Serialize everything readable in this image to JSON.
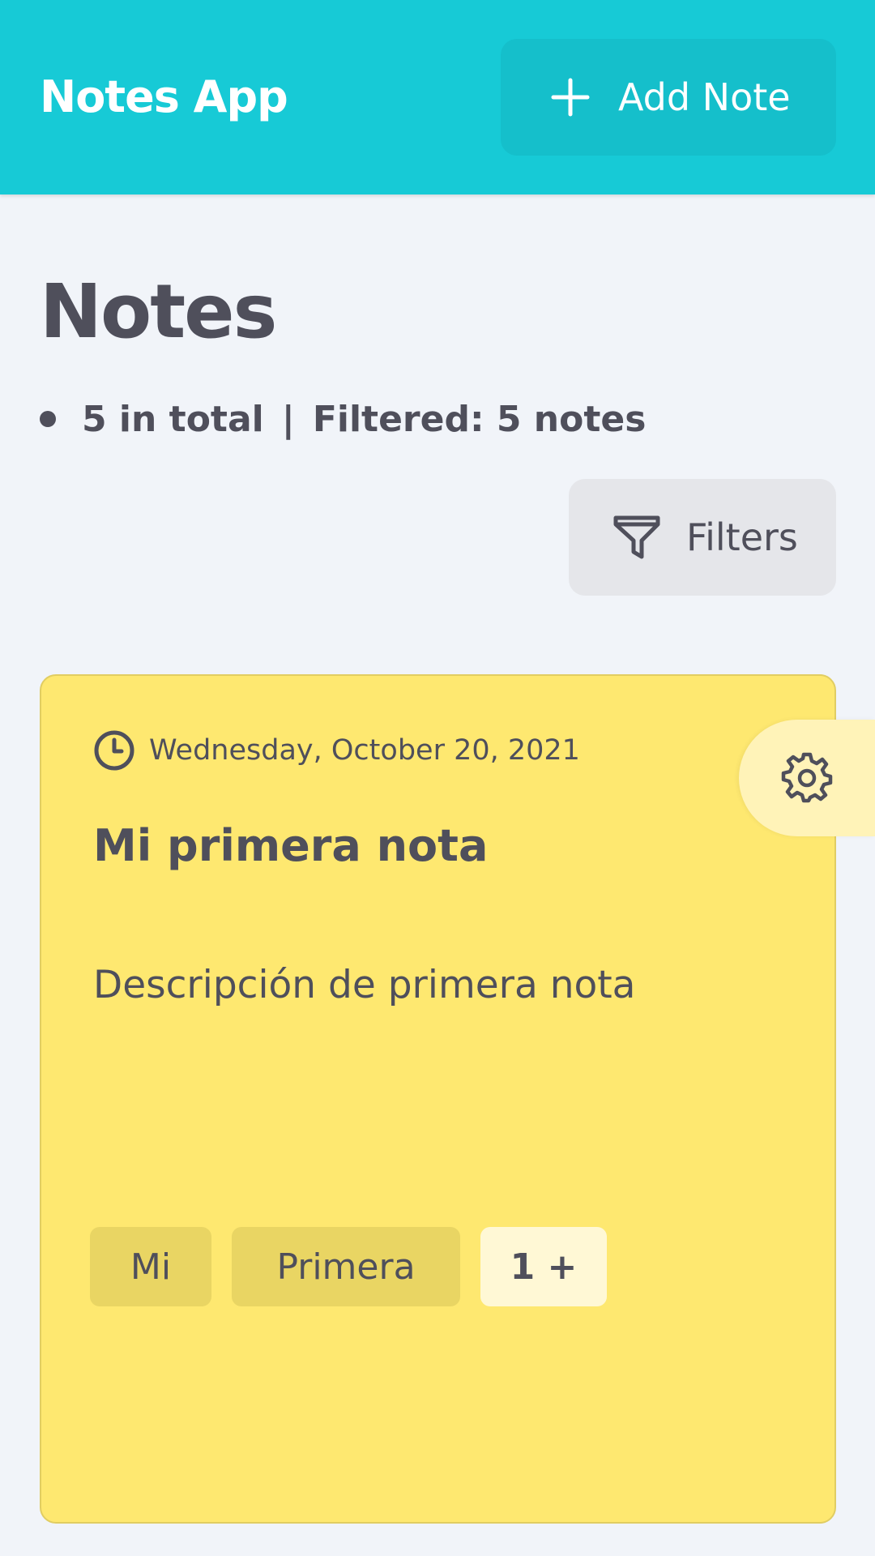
{
  "header": {
    "app_title": "Notes App",
    "add_button_label": "Add Note",
    "add_button_icon": "plus-icon",
    "background_color": "#17cad6"
  },
  "page": {
    "title": "Notes",
    "summary": {
      "total_label": "5 in total",
      "separator": "|",
      "filtered_label": "Filtered: 5 notes"
    },
    "filters_button_label": "Filters",
    "filters_icon": "funnel-icon"
  },
  "notes": [
    {
      "date": "Wednesday, October 20, 2021",
      "date_icon": "clock-icon",
      "title": "Mi primera nota",
      "description": "Descripción de primera nota",
      "tags": [
        "Mi",
        "Primera"
      ],
      "more_tags_label": "1 +",
      "settings_icon": "gear-icon",
      "card_color": "#fee870"
    }
  ]
}
